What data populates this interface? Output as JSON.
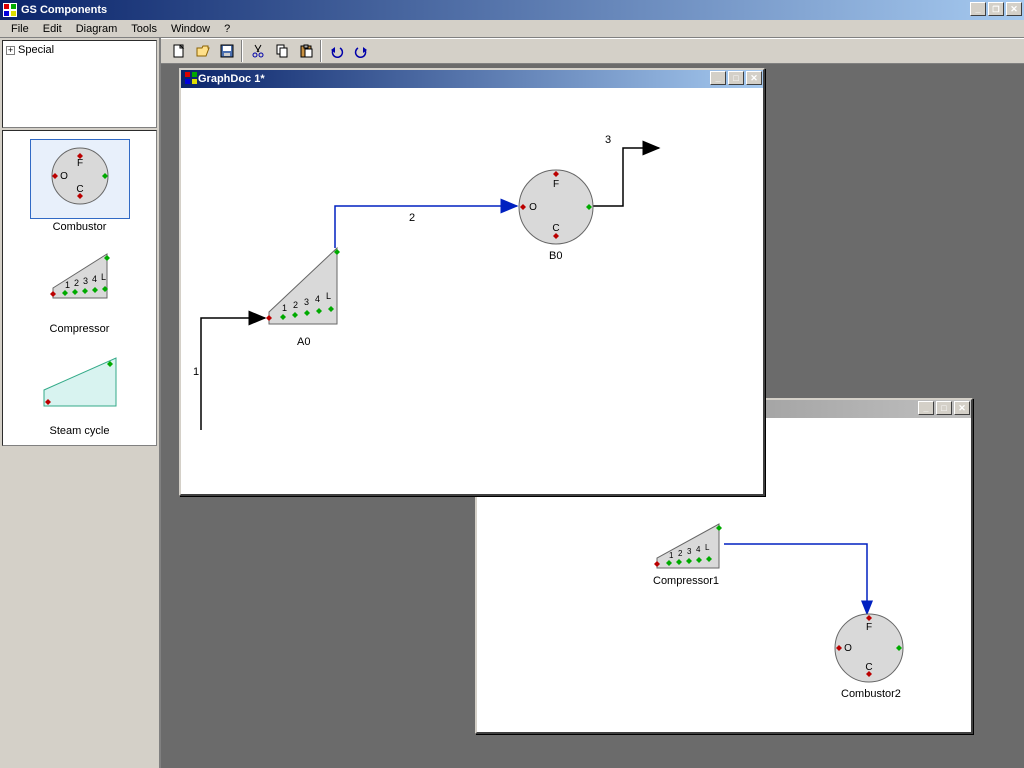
{
  "app": {
    "title": "GS Components"
  },
  "menu": {
    "file": "File",
    "edit": "Edit",
    "diagram": "Diagram",
    "tools": "Tools",
    "window": "Window",
    "help": "?"
  },
  "toolbar": {
    "new": "New",
    "open": "Open",
    "save": "Save",
    "cut": "Cut",
    "copy": "Copy",
    "paste": "Paste",
    "undo": "Undo",
    "redo": "Redo"
  },
  "sidebar": {
    "tree": {
      "root": "Special"
    },
    "palette": [
      {
        "id": "combustor",
        "label": "Combustor"
      },
      {
        "id": "compressor",
        "label": "Compressor"
      },
      {
        "id": "steamcycle",
        "label": "Steam cycle"
      }
    ]
  },
  "combustor_ports": {
    "F": "F",
    "O": "O",
    "C": "C"
  },
  "compressor_ports": {
    "p1": "1",
    "p2": "2",
    "p3": "3",
    "p4": "4",
    "pL": "L"
  },
  "doc1": {
    "title": "GraphDoc 1*",
    "nodes": {
      "A0": {
        "label": "A0"
      },
      "B0": {
        "label": "B0"
      }
    },
    "edges": {
      "e1": "1",
      "e2": "2",
      "e3": "3"
    }
  },
  "doc2": {
    "nodes": {
      "Compressor1": {
        "label": "Compressor1"
      },
      "Combustor2": {
        "label": "Combustor2"
      }
    }
  }
}
